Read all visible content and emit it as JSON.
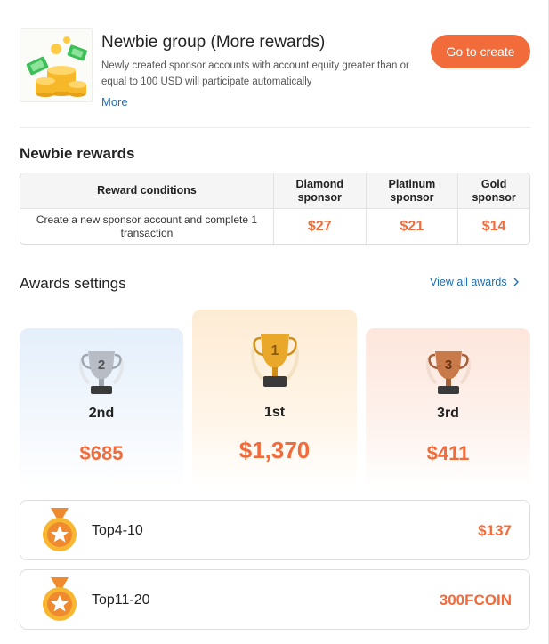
{
  "colors": {
    "accent": "#f26b3a",
    "link": "#1e6fb4"
  },
  "newbie_group": {
    "title": "Newbie group (More rewards)",
    "description": "Newly created sponsor accounts with account equity greater than or equal to 100 USD will participate automatically",
    "more_label": "More",
    "cta_label": "Go to create",
    "image_icon": "coin-stack-illustration"
  },
  "newbie_rewards": {
    "title": "Newbie rewards",
    "headers": [
      "Reward conditions",
      "Diamond sponsor",
      "Platinum sponsor",
      "Gold sponsor"
    ],
    "rows": [
      {
        "condition": "Create a new sponsor account and complete 1 transaction",
        "diamond": "$27",
        "platinum": "$21",
        "gold": "$14"
      }
    ]
  },
  "awards": {
    "title": "Awards settings",
    "view_all_label": "View all awards",
    "view_all_icon": "chevron-right-icon",
    "podium": [
      {
        "rank": "2nd",
        "badge": "2",
        "prize": "$685",
        "icon": "silver-trophy-icon"
      },
      {
        "rank": "1st",
        "badge": "1",
        "prize": "$1,370",
        "icon": "gold-trophy-icon"
      },
      {
        "rank": "3rd",
        "badge": "3",
        "prize": "$411",
        "icon": "bronze-trophy-icon"
      }
    ],
    "tiers": [
      {
        "name": "Top4-10",
        "prize": "$137",
        "icon": "medal-star-icon"
      },
      {
        "name": "Top11-20",
        "prize": "300FCOIN",
        "icon": "medal-star-icon"
      }
    ]
  }
}
